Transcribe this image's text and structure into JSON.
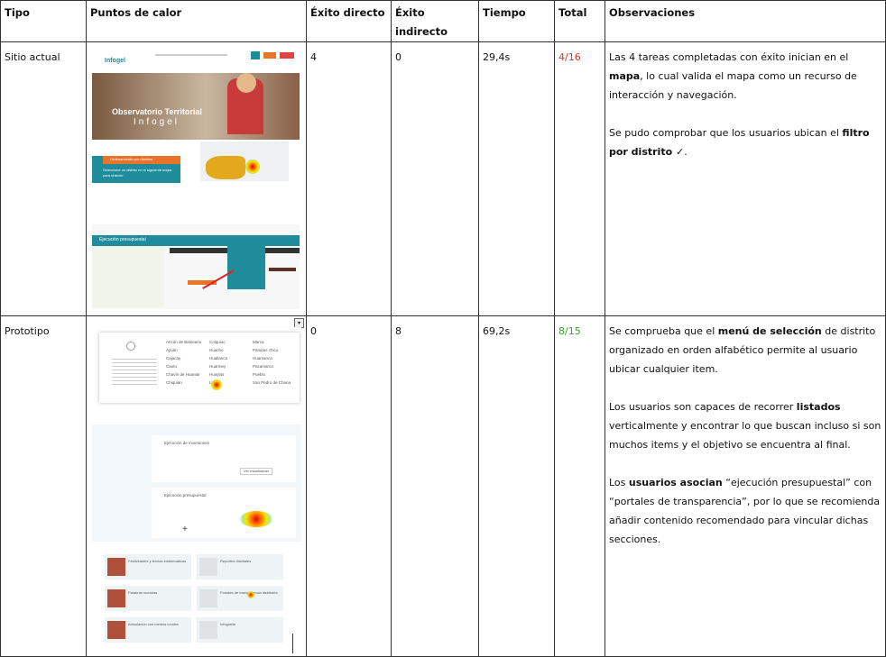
{
  "table": {
    "headers": {
      "tipo": "Tipo",
      "puntos": "Puntos de calor",
      "exito_directo": "Éxito directo",
      "exito_indirecto": "Éxito indirecto",
      "tiempo": "Tiempo",
      "total": "Total",
      "observaciones": "Observaciones"
    },
    "rows": [
      {
        "tipo": "Sitio actual",
        "exito_directo": "4",
        "exito_indirecto": "0",
        "tiempo": "29,4s",
        "total": "4/16",
        "total_color": "#d9362b",
        "obs1_a": "Las 4 tareas completadas con éxito inician en el ",
        "obs1_b": "mapa",
        "obs1_c": ", lo cual valida el mapa como un recurso de interacción y navegación.",
        "obs2_a": "Se pudo comprobar que los usuarios ubican el ",
        "obs2_b": "filtro por distrito ✓",
        "obs2_c": "."
      },
      {
        "tipo": "Prototipo",
        "exito_directo": "0",
        "exito_indirecto": "8",
        "tiempo": "69,2s",
        "total": "8/15",
        "total_color": "#3a9a3a",
        "obs1_a": "Se comprueba que el ",
        "obs1_b": "menú de selección",
        "obs1_c": " de distrito organizado en orden alfabético permite al usuario ubicar cualquier item.",
        "obs2_a": "Los usuarios son capaces de recorrer ",
        "obs2_b": "listados",
        "obs2_c": " verticalmente y encontrar lo que buscan incluso si son muchos items y el objetivo se encuentra al final.",
        "obs3_a": "Los ",
        "obs3_b": "usuarios asocian",
        "obs3_c": " “ejecución presupuestal”  con “portales de transparencia”, por lo que se recomienda añadir contenido recomendado para vincular dichas secciones."
      }
    ]
  },
  "thumbs": {
    "site": {
      "logo": "Infogel",
      "banner_title": "Observatorio Territorial",
      "banner_sub": "Infogel",
      "filter_label": "Ordenamiento por distritos",
      "filter_text": "Seleccione un distrito en el siguiente mapa para obtener",
      "chart_caption": "Ejecución presupuestal"
    },
    "proto": {
      "districts": [
        "Ancón de Balneario",
        "Ayuán",
        "Cajacay",
        "Caoto",
        "Chavín de Huantar",
        "Chiquián",
        "Colquioc",
        "Huacho",
        "Huallanca",
        "Huarmey",
        "Huaylas",
        "Llacón",
        "Marca",
        "Pampas chico",
        "Huamanca",
        "Pacamarca",
        "Pueblo",
        "San Pedro de Chana"
      ],
      "card1": "Ejecución de Inversiones",
      "card2": "Ejecución presupuestal",
      "btn": "Ver estadísticas",
      "tiles": [
        "Festividades y fechas emblemáticas",
        "Reportes distritales",
        "Palabras nuestras",
        "Portales de transparencia distritales",
        "Articulación con medios locales",
        "Infografía"
      ]
    },
    "colors": {
      "teal": "#1f8c9c",
      "orange": "#e8742a",
      "red_header": "#c0392b"
    }
  }
}
